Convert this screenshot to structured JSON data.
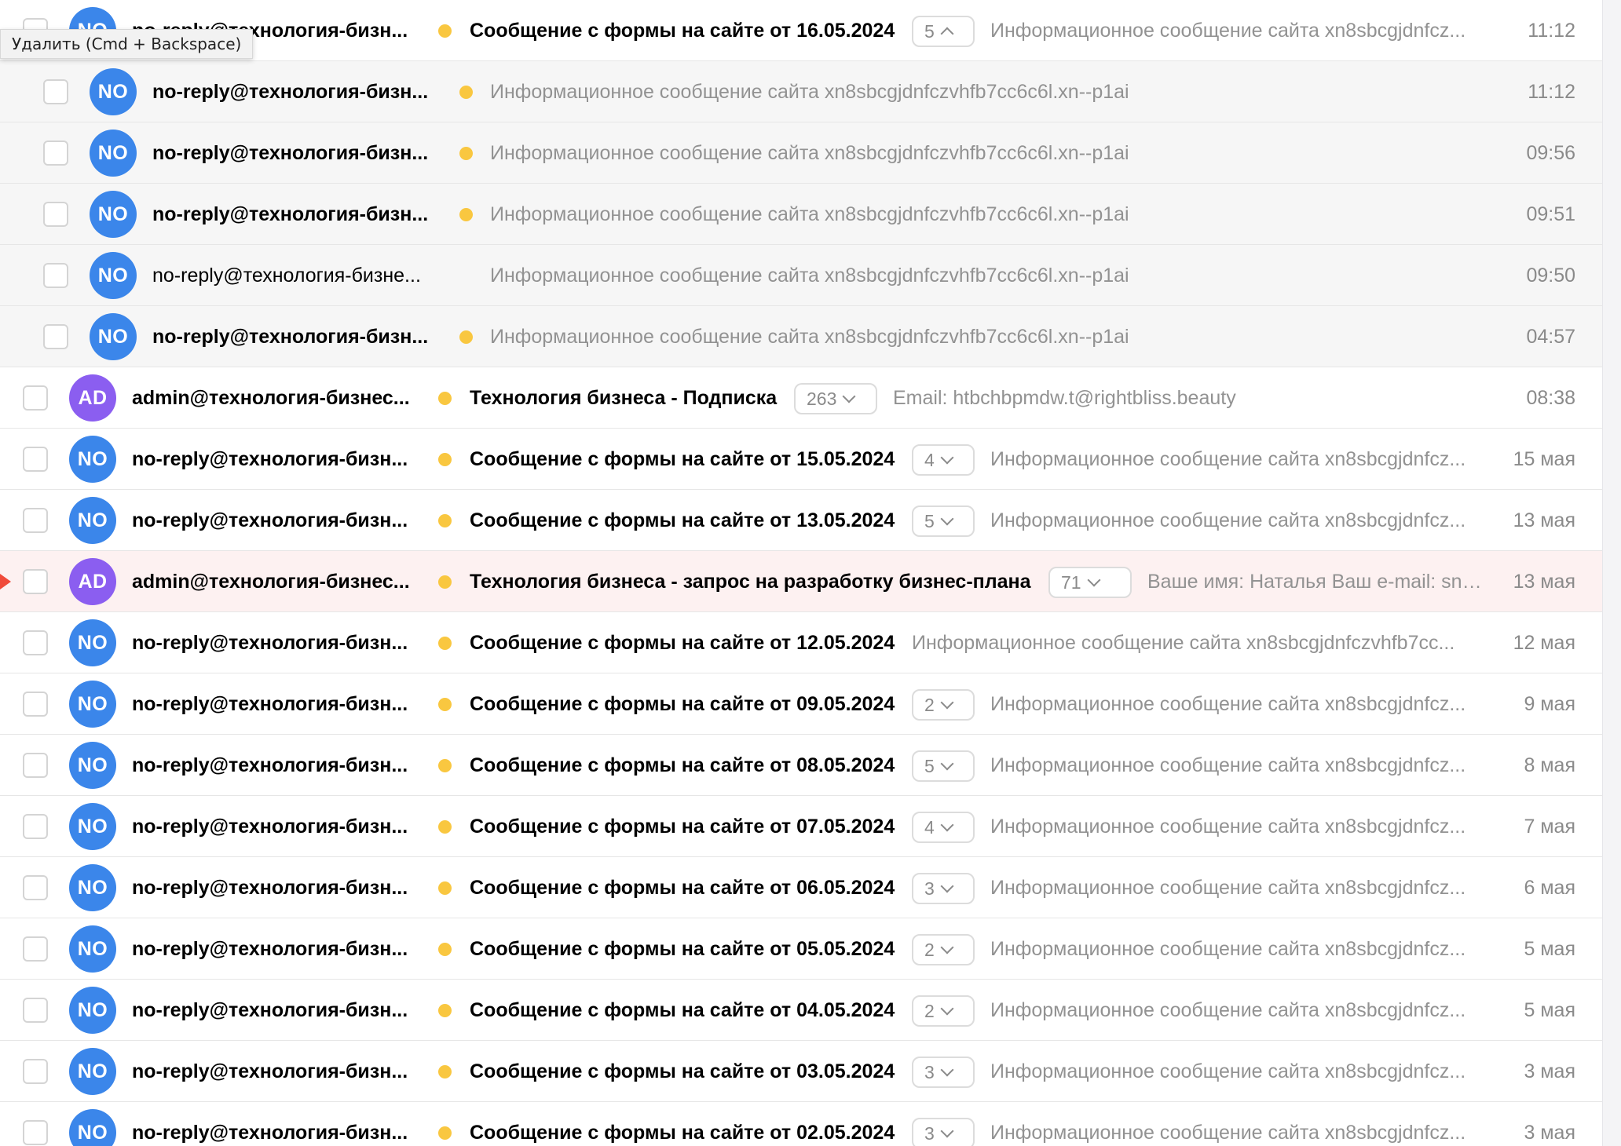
{
  "tooltip": "Удалить (Cmd + Backspace)",
  "colors": {
    "avatar_no": "#3b86ea",
    "avatar_ad": "#8b5ef0",
    "unread_dot": "#f9c740",
    "flag": "#f04b3a"
  },
  "rows": [
    {
      "avatar": "NO",
      "sender": "no-reply@технология-бизн...",
      "subject": "Сообщение с формы на сайте от 16.05.2024",
      "count": "5",
      "expanded": true,
      "snippet": "Информационное сообщение сайта xn8sbcgjdnfcz...",
      "date": "11:12"
    },
    {
      "avatar": "NO",
      "sender": "no-reply@технология-бизн...",
      "snippet": "Информационное сообщение сайта xn8sbcgjdnfczvhfb7cc6c6l.xn--p1ai",
      "date": "11:12",
      "child": true
    },
    {
      "avatar": "NO",
      "sender": "no-reply@технология-бизн...",
      "snippet": "Информационное сообщение сайта xn8sbcgjdnfczvhfb7cc6c6l.xn--p1ai",
      "date": "09:56",
      "child": true
    },
    {
      "avatar": "NO",
      "sender": "no-reply@технология-бизн...",
      "snippet": "Информационное сообщение сайта xn8sbcgjdnfczvhfb7cc6c6l.xn--p1ai",
      "date": "09:51",
      "child": true
    },
    {
      "avatar": "NO",
      "sender": "no-reply@технология-бизне...",
      "snippet": "Информационное сообщение сайта xn8sbcgjdnfczvhfb7cc6c6l.xn--p1ai",
      "date": "09:50",
      "child": true,
      "read": true
    },
    {
      "avatar": "NO",
      "sender": "no-reply@технология-бизн...",
      "snippet": "Информационное сообщение сайта xn8sbcgjdnfczvhfb7cc6c6l.xn--p1ai",
      "date": "04:57",
      "child": true
    },
    {
      "avatar": "AD",
      "sender": "admin@технология-бизнес...",
      "subject": "Технология бизнеса - Подписка",
      "count": "263",
      "snippet": "Email: htbchbpmdw.t@rightbliss.beauty",
      "date": "08:38"
    },
    {
      "avatar": "NO",
      "sender": "no-reply@технология-бизн...",
      "subject": "Сообщение с формы на сайте от 15.05.2024",
      "count": "4",
      "snippet": "Информационное сообщение сайта xn8sbcgjdnfcz...",
      "date": "15 мая"
    },
    {
      "avatar": "NO",
      "sender": "no-reply@технология-бизн...",
      "subject": "Сообщение с формы на сайте от 13.05.2024",
      "count": "5",
      "snippet": "Информационное сообщение сайта xn8sbcgjdnfcz...",
      "date": "13 мая"
    },
    {
      "avatar": "AD",
      "sender": "admin@технология-бизнес...",
      "subject": "Технология бизнеса - запрос на разработку бизнес-плана",
      "count": "71",
      "snippet": "Ваше имя: Наталья Ваш e-mail: sno...",
      "date": "13 мая",
      "flagged": true
    },
    {
      "avatar": "NO",
      "sender": "no-reply@технология-бизн...",
      "subject": "Сообщение с формы на сайте от 12.05.2024",
      "snippet": "Информационное сообщение сайта xn8sbcgjdnfczvhfb7cc...",
      "date": "12 мая"
    },
    {
      "avatar": "NO",
      "sender": "no-reply@технология-бизн...",
      "subject": "Сообщение с формы на сайте от 09.05.2024",
      "count": "2",
      "snippet": "Информационное сообщение сайта xn8sbcgjdnfcz...",
      "date": "9 мая"
    },
    {
      "avatar": "NO",
      "sender": "no-reply@технология-бизн...",
      "subject": "Сообщение с формы на сайте от 08.05.2024",
      "count": "5",
      "snippet": "Информационное сообщение сайта xn8sbcgjdnfcz...",
      "date": "8 мая"
    },
    {
      "avatar": "NO",
      "sender": "no-reply@технология-бизн...",
      "subject": "Сообщение с формы на сайте от 07.05.2024",
      "count": "4",
      "snippet": "Информационное сообщение сайта xn8sbcgjdnfcz...",
      "date": "7 мая"
    },
    {
      "avatar": "NO",
      "sender": "no-reply@технология-бизн...",
      "subject": "Сообщение с формы на сайте от 06.05.2024",
      "count": "3",
      "snippet": "Информационное сообщение сайта xn8sbcgjdnfcz...",
      "date": "6 мая"
    },
    {
      "avatar": "NO",
      "sender": "no-reply@технология-бизн...",
      "subject": "Сообщение с формы на сайте от 05.05.2024",
      "count": "2",
      "snippet": "Информационное сообщение сайта xn8sbcgjdnfcz...",
      "date": "5 мая"
    },
    {
      "avatar": "NO",
      "sender": "no-reply@технология-бизн...",
      "subject": "Сообщение с формы на сайте от 04.05.2024",
      "count": "2",
      "snippet": "Информационное сообщение сайта xn8sbcgjdnfcz...",
      "date": "5 мая"
    },
    {
      "avatar": "NO",
      "sender": "no-reply@технология-бизн...",
      "subject": "Сообщение с формы на сайте от 03.05.2024",
      "count": "3",
      "snippet": "Информационное сообщение сайта xn8sbcgjdnfcz...",
      "date": "3 мая"
    },
    {
      "avatar": "NO",
      "sender": "no-reply@технология-бизн...",
      "subject": "Сообщение с формы на сайте от 02.05.2024",
      "count": "3",
      "snippet": "Информационное сообщение сайта xn8sbcgjdnfcz...",
      "date": "3 мая"
    }
  ]
}
